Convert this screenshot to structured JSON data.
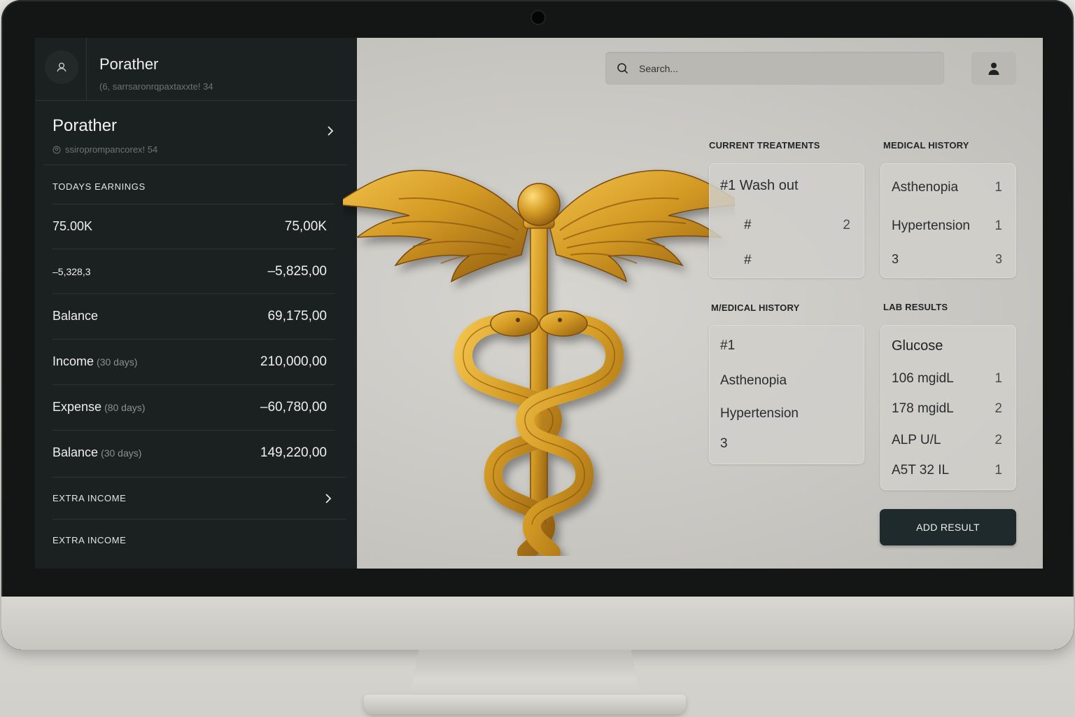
{
  "sidebar": {
    "header": {
      "title": "Porather",
      "subtitle": "(6, sarrsaronrqpaxtaxxte! 34"
    },
    "account": {
      "name": "Porather",
      "subtitle": "ssiropromрancorex! 54"
    },
    "todays_earnings_label": "TODAYS EARNINGS",
    "rows": [
      {
        "label": "75.00K",
        "note": "",
        "value": "75,00K"
      },
      {
        "label": "–5,328,3",
        "note": "",
        "value": "–5,825,00"
      },
      {
        "label": "Balance",
        "note": "",
        "value": "69,175,00"
      },
      {
        "label": "Income",
        "note": "(30 days)",
        "value": "210,000,00"
      },
      {
        "label": "Expense",
        "note": "(80 days)",
        "value": "–60,780,00"
      },
      {
        "label": "Balance",
        "note": "(30 days)",
        "value": "149,220,00"
      }
    ],
    "extra_income_1": "EXTRA INCOME",
    "extra_income_2": "EXTRA INCOME"
  },
  "topbar": {
    "search_placeholder": "Search..."
  },
  "current_treatments": {
    "title": "CURRENT TREATMENTS",
    "items": [
      {
        "label": "#1  Wash out",
        "num": ""
      },
      {
        "label": "#",
        "num": "2"
      },
      {
        "label": "#",
        "num": ""
      }
    ]
  },
  "medical_history": {
    "title": "MEDICAL HISTORY",
    "items": [
      {
        "label": "Asthenopia",
        "num": "1"
      },
      {
        "label": "Hypertension",
        "num": "1"
      },
      {
        "label": "3",
        "num": "3"
      }
    ]
  },
  "medical_history_2": {
    "title": "M/EDICAL HISTORY",
    "items": [
      "#1",
      "Asthenopia",
      "Hypertension",
      "3"
    ]
  },
  "lab_results": {
    "title": "LAB RESULTS",
    "heading": "Glucose",
    "items": [
      {
        "label": "106  mgidL",
        "num": "1"
      },
      {
        "label": "178  mgidL",
        "num": "2"
      },
      {
        "label": "ALP  U/L",
        "num": "2"
      },
      {
        "label": "A5T  32 IL",
        "num": "1"
      }
    ]
  },
  "add_result_label": "ADD RESULT",
  "colors": {
    "sidebar_bg": "#1b2020",
    "main_bg": "#c9c8c3",
    "emblem_gold": "#c98f1f",
    "button_bg": "#1f2a2c"
  },
  "icons": {
    "avatar": "user-icon",
    "chevron": "chevron-right-icon",
    "search": "search-icon",
    "profile": "person-icon",
    "emblem": "caduceus-icon"
  }
}
